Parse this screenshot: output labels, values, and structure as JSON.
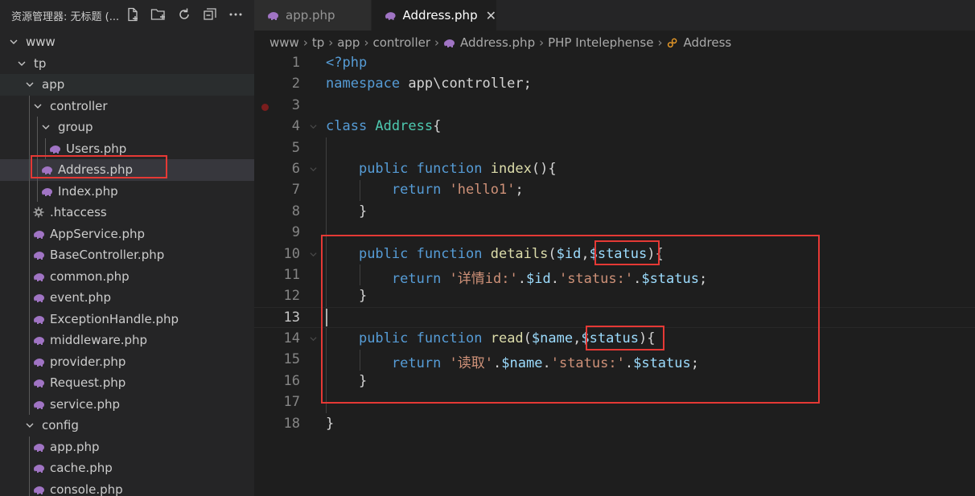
{
  "explorer": {
    "title": "资源管理器: 无标题 (..."
  },
  "tree": [
    {
      "label": "www",
      "depth": 0,
      "type": "folder"
    },
    {
      "label": "tp",
      "depth": 1,
      "type": "folder"
    },
    {
      "label": "app",
      "depth": 2,
      "type": "folder"
    },
    {
      "label": "controller",
      "depth": 3,
      "type": "folder"
    },
    {
      "label": "group",
      "depth": 4,
      "type": "folder"
    },
    {
      "label": "Users.php",
      "depth": 5,
      "type": "php"
    },
    {
      "label": "Address.php",
      "depth": 4,
      "type": "php",
      "selected": true
    },
    {
      "label": "Index.php",
      "depth": 4,
      "type": "php"
    },
    {
      "label": ".htaccess",
      "depth": 3,
      "type": "gear"
    },
    {
      "label": "AppService.php",
      "depth": 3,
      "type": "php"
    },
    {
      "label": "BaseController.php",
      "depth": 3,
      "type": "php"
    },
    {
      "label": "common.php",
      "depth": 3,
      "type": "php"
    },
    {
      "label": "event.php",
      "depth": 3,
      "type": "php"
    },
    {
      "label": "ExceptionHandle.php",
      "depth": 3,
      "type": "php"
    },
    {
      "label": "middleware.php",
      "depth": 3,
      "type": "php"
    },
    {
      "label": "provider.php",
      "depth": 3,
      "type": "php"
    },
    {
      "label": "Request.php",
      "depth": 3,
      "type": "php"
    },
    {
      "label": "service.php",
      "depth": 3,
      "type": "php"
    },
    {
      "label": "config",
      "depth": 2,
      "type": "folder"
    },
    {
      "label": "app.php",
      "depth": 3,
      "type": "php"
    },
    {
      "label": "cache.php",
      "depth": 3,
      "type": "php"
    },
    {
      "label": "console.php",
      "depth": 3,
      "type": "php"
    }
  ],
  "tabs": [
    {
      "label": "app.php"
    },
    {
      "label": "Address.php",
      "close": "✕"
    }
  ],
  "breadcrumb": [
    "www",
    "tp",
    "app",
    "controller",
    "Address.php",
    "PHP Intelephense",
    "Address"
  ],
  "lines": [
    {
      "n": "1",
      "tokens": [
        [
          "k",
          "<?php"
        ]
      ]
    },
    {
      "n": "2",
      "tokens": [
        [
          "k",
          "namespace "
        ],
        [
          "p",
          "app\\controller;"
        ]
      ]
    },
    {
      "n": "3",
      "tokens": []
    },
    {
      "n": "4",
      "tokens": [
        [
          "k",
          "class "
        ],
        [
          "c",
          "Address"
        ],
        [
          "p",
          "{"
        ]
      ]
    },
    {
      "n": "5",
      "tokens": []
    },
    {
      "n": "6",
      "tokens": [
        [
          "p",
          "    "
        ],
        [
          "k",
          "public function "
        ],
        [
          "f",
          "index"
        ],
        [
          "p",
          "(){"
        ]
      ]
    },
    {
      "n": "7",
      "tokens": [
        [
          "p",
          "        "
        ],
        [
          "k",
          "return "
        ],
        [
          "s",
          "'hello1'"
        ],
        [
          "p",
          ";"
        ]
      ]
    },
    {
      "n": "8",
      "tokens": [
        [
          "p",
          "    }"
        ]
      ]
    },
    {
      "n": "9",
      "tokens": []
    },
    {
      "n": "10",
      "tokens": [
        [
          "p",
          "    "
        ],
        [
          "k",
          "public function "
        ],
        [
          "f",
          "details"
        ],
        [
          "p",
          "("
        ],
        [
          "v",
          "$id"
        ],
        [
          "p",
          ","
        ],
        [
          "v",
          "$status"
        ],
        [
          "p",
          "){"
        ]
      ]
    },
    {
      "n": "11",
      "tokens": [
        [
          "p",
          "        "
        ],
        [
          "k",
          "return "
        ],
        [
          "s",
          "'详情id:'"
        ],
        [
          "p",
          "."
        ],
        [
          "v",
          "$id"
        ],
        [
          "p",
          "."
        ],
        [
          "s",
          "'status:'"
        ],
        [
          "p",
          "."
        ],
        [
          "v",
          "$status"
        ],
        [
          "p",
          ";"
        ]
      ]
    },
    {
      "n": "12",
      "tokens": [
        [
          "p",
          "    }"
        ]
      ]
    },
    {
      "n": "13",
      "tokens": []
    },
    {
      "n": "14",
      "tokens": [
        [
          "p",
          "    "
        ],
        [
          "k",
          "public function "
        ],
        [
          "f",
          "read"
        ],
        [
          "p",
          "("
        ],
        [
          "v",
          "$name"
        ],
        [
          "p",
          ","
        ],
        [
          "v",
          "$status"
        ],
        [
          "p",
          "){"
        ]
      ]
    },
    {
      "n": "15",
      "tokens": [
        [
          "p",
          "        "
        ],
        [
          "k",
          "return "
        ],
        [
          "s",
          "'读取'"
        ],
        [
          "p",
          "."
        ],
        [
          "v",
          "$name"
        ],
        [
          "p",
          "."
        ],
        [
          "s",
          "'status:'"
        ],
        [
          "p",
          "."
        ],
        [
          "v",
          "$status"
        ],
        [
          "p",
          ";"
        ]
      ]
    },
    {
      "n": "16",
      "tokens": [
        [
          "p",
          "    }"
        ]
      ]
    },
    {
      "n": "17",
      "tokens": []
    },
    {
      "n": "18",
      "tokens": [
        [
          "p",
          "}"
        ]
      ]
    }
  ],
  "colors": {
    "highlight": "#e53935",
    "php_icon": "#a074c4"
  }
}
